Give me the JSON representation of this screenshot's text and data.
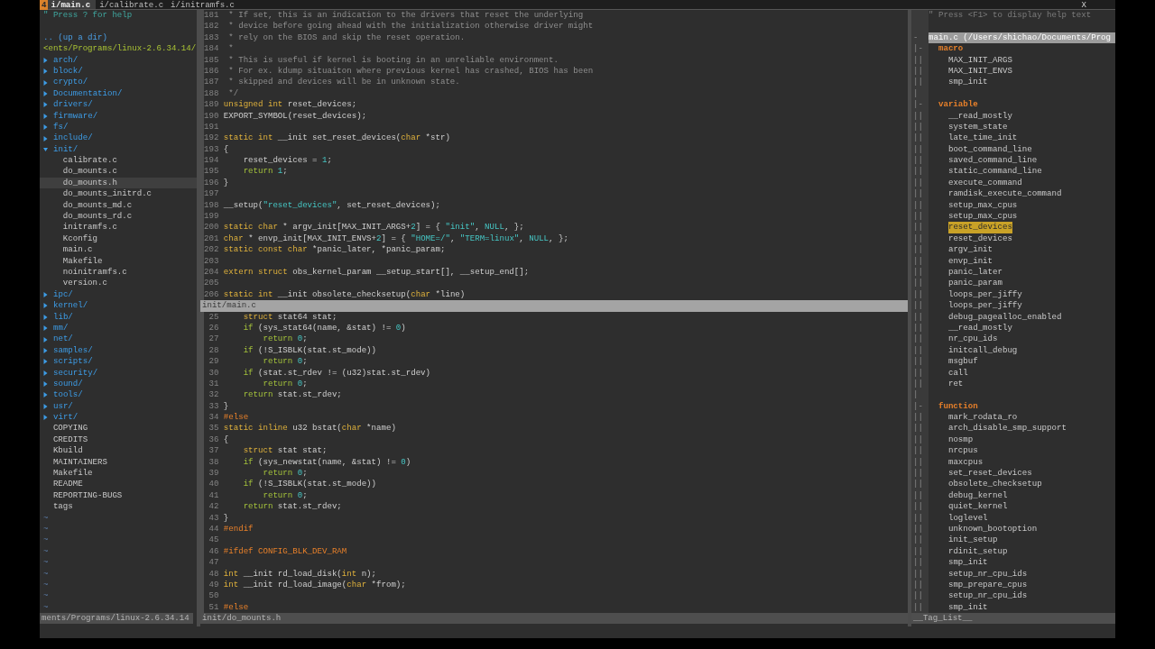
{
  "tabline": {
    "tabs": [
      {
        "count": "4",
        "label": "i/main.c",
        "selected": true
      },
      {
        "label": "i/calibrate.c",
        "selected": false
      },
      {
        "label": "i/initramfs.c",
        "selected": false
      }
    ],
    "close": "X"
  },
  "file_tree": {
    "help": "\" Press ? for help",
    "up_dir": ".. (up a dir)",
    "root": "<ents/Programs/linux-2.6.34.14/",
    "items": [
      {
        "kind": "dir",
        "name": "arch/",
        "expanded": false,
        "selected": false
      },
      {
        "kind": "dir",
        "name": "block/",
        "expanded": false,
        "selected": false
      },
      {
        "kind": "dir",
        "name": "crypto/",
        "expanded": false,
        "selected": false
      },
      {
        "kind": "dir",
        "name": "Documentation/",
        "expanded": false,
        "selected": false
      },
      {
        "kind": "dir",
        "name": "drivers/",
        "expanded": false,
        "selected": false
      },
      {
        "kind": "dir",
        "name": "firmware/",
        "expanded": false,
        "selected": false
      },
      {
        "kind": "dir",
        "name": "fs/",
        "expanded": false,
        "selected": false
      },
      {
        "kind": "dir",
        "name": "include/",
        "expanded": false,
        "selected": false
      },
      {
        "kind": "dir",
        "name": "init/",
        "expanded": true,
        "selected": false,
        "children": [
          {
            "kind": "file",
            "name": "calibrate.c",
            "selected": false
          },
          {
            "kind": "file",
            "name": "do_mounts.c",
            "selected": false
          },
          {
            "kind": "file",
            "name": "do_mounts.h",
            "selected": true
          },
          {
            "kind": "file",
            "name": "do_mounts_initrd.c",
            "selected": false
          },
          {
            "kind": "file",
            "name": "do_mounts_md.c",
            "selected": false
          },
          {
            "kind": "file",
            "name": "do_mounts_rd.c",
            "selected": false
          },
          {
            "kind": "file",
            "name": "initramfs.c",
            "selected": false
          },
          {
            "kind": "file",
            "name": "Kconfig",
            "selected": false
          },
          {
            "kind": "file",
            "name": "main.c",
            "selected": false
          },
          {
            "kind": "file",
            "name": "Makefile",
            "selected": false
          },
          {
            "kind": "file",
            "name": "noinitramfs.c",
            "selected": false
          },
          {
            "kind": "file",
            "name": "version.c",
            "selected": false
          }
        ]
      },
      {
        "kind": "dir",
        "name": "ipc/",
        "expanded": false,
        "selected": false
      },
      {
        "kind": "dir",
        "name": "kernel/",
        "expanded": false,
        "selected": false
      },
      {
        "kind": "dir",
        "name": "lib/",
        "expanded": false,
        "selected": false
      },
      {
        "kind": "dir",
        "name": "mm/",
        "expanded": false,
        "selected": false
      },
      {
        "kind": "dir",
        "name": "net/",
        "expanded": false,
        "selected": false
      },
      {
        "kind": "dir",
        "name": "samples/",
        "expanded": false,
        "selected": false
      },
      {
        "kind": "dir",
        "name": "scripts/",
        "expanded": false,
        "selected": false
      },
      {
        "kind": "dir",
        "name": "security/",
        "expanded": false,
        "selected": false
      },
      {
        "kind": "dir",
        "name": "sound/",
        "expanded": false,
        "selected": false
      },
      {
        "kind": "dir",
        "name": "tools/",
        "expanded": false,
        "selected": false
      },
      {
        "kind": "dir",
        "name": "usr/",
        "expanded": false,
        "selected": false
      },
      {
        "kind": "dir",
        "name": "virt/",
        "expanded": false,
        "selected": false
      },
      {
        "kind": "file",
        "name": "COPYING",
        "selected": false
      },
      {
        "kind": "file",
        "name": "CREDITS",
        "selected": false
      },
      {
        "kind": "file",
        "name": "Kbuild",
        "selected": false
      },
      {
        "kind": "file",
        "name": "MAINTAINERS",
        "selected": false
      },
      {
        "kind": "file",
        "name": "Makefile",
        "selected": false
      },
      {
        "kind": "file",
        "name": "README",
        "selected": false
      },
      {
        "kind": "file",
        "name": "REPORTING-BUGS",
        "selected": false
      },
      {
        "kind": "file",
        "name": "tags",
        "selected": false
      }
    ],
    "filler": [
      "~",
      "~",
      "~",
      "~",
      "~",
      "~",
      "~",
      "~",
      "~"
    ],
    "status": {
      "text": "ments/Programs/linux-2.6.34.14",
      "current": false
    }
  },
  "editor": {
    "windows": [
      {
        "status": {
          "text": "init/main.c",
          "current": true
        },
        "lines": [
          {
            "num": "181",
            "segments": [
              {
                "kind": "comment",
                "text": " * If set, this is an indication to the drivers that reset the underlying"
              }
            ]
          },
          {
            "num": "182",
            "segments": [
              {
                "kind": "comment",
                "text": " * device before going ahead with the initialization otherwise driver might"
              }
            ]
          },
          {
            "num": "183",
            "segments": [
              {
                "kind": "comment",
                "text": " * rely on the BIOS and skip the reset operation."
              }
            ]
          },
          {
            "num": "184",
            "segments": [
              {
                "kind": "comment",
                "text": " *"
              }
            ]
          },
          {
            "num": "185",
            "segments": [
              {
                "kind": "comment",
                "text": " * This is useful if kernel is booting in an unreliable environment."
              }
            ]
          },
          {
            "num": "186",
            "segments": [
              {
                "kind": "comment",
                "text": " * For ex. kdump situaiton where previous kernel has crashed, BIOS has been"
              }
            ]
          },
          {
            "num": "187",
            "segments": [
              {
                "kind": "comment",
                "text": " * skipped and devices will be in unknown state."
              }
            ]
          },
          {
            "num": "188",
            "segments": [
              {
                "kind": "comment",
                "text": " */"
              }
            ]
          },
          {
            "num": "189",
            "segments": [
              {
                "kind": "type",
                "text": "unsigned int"
              },
              {
                "kind": "plain",
                "text": " reset_devices;"
              }
            ]
          },
          {
            "num": "190",
            "segments": [
              {
                "kind": "plain",
                "text": "EXPORT_SYMBOL(reset_devices);"
              }
            ]
          },
          {
            "num": "191"
          },
          {
            "num": "192",
            "segments": [
              {
                "kind": "type",
                "text": "static int"
              },
              {
                "kind": "plain",
                "text": " __init set_reset_devices("
              },
              {
                "kind": "type",
                "text": "char"
              },
              {
                "kind": "plain",
                "text": " *str)"
              }
            ]
          },
          {
            "num": "193",
            "segments": [
              {
                "kind": "plain",
                "text": "{"
              }
            ]
          },
          {
            "num": "194",
            "segments": [
              {
                "kind": "plain",
                "text": "    reset_devices = "
              },
              {
                "kind": "constant",
                "text": "1"
              },
              {
                "kind": "plain",
                "text": ";"
              }
            ]
          },
          {
            "num": "195",
            "segments": [
              {
                "kind": "statement",
                "text": "    return"
              },
              {
                "kind": "constant",
                "text": " 1"
              },
              {
                "kind": "plain",
                "text": ";"
              }
            ]
          },
          {
            "num": "196",
            "segments": [
              {
                "kind": "plain",
                "text": "}"
              }
            ]
          },
          {
            "num": "197"
          },
          {
            "num": "198",
            "segments": [
              {
                "kind": "plain",
                "text": "__setup("
              },
              {
                "kind": "constant",
                "text": "\"reset_devices\""
              },
              {
                "kind": "plain",
                "text": ", set_reset_devices);"
              }
            ]
          },
          {
            "num": "199"
          },
          {
            "num": "200",
            "segments": [
              {
                "kind": "type",
                "text": "static char"
              },
              {
                "kind": "plain",
                "text": " * argv_init[MAX_INIT_ARGS+"
              },
              {
                "kind": "constant",
                "text": "2"
              },
              {
                "kind": "plain",
                "text": "] = { "
              },
              {
                "kind": "constant",
                "text": "\"init\""
              },
              {
                "kind": "plain",
                "text": ", "
              },
              {
                "kind": "constant",
                "text": "NULL"
              },
              {
                "kind": "plain",
                "text": ", };"
              }
            ]
          },
          {
            "num": "201",
            "segments": [
              {
                "kind": "type",
                "text": "char"
              },
              {
                "kind": "plain",
                "text": " * envp_init[MAX_INIT_ENVS+"
              },
              {
                "kind": "constant",
                "text": "2"
              },
              {
                "kind": "plain",
                "text": "] = { "
              },
              {
                "kind": "constant",
                "text": "\"HOME=/\""
              },
              {
                "kind": "plain",
                "text": ", "
              },
              {
                "kind": "constant",
                "text": "\"TERM=linux\""
              },
              {
                "kind": "plain",
                "text": ", "
              },
              {
                "kind": "constant",
                "text": "NULL"
              },
              {
                "kind": "plain",
                "text": ", };"
              }
            ]
          },
          {
            "num": "202",
            "segments": [
              {
                "kind": "type",
                "text": "static const char"
              },
              {
                "kind": "plain",
                "text": " *panic_later, *panic_param;"
              }
            ]
          },
          {
            "num": "203"
          },
          {
            "num": "204",
            "segments": [
              {
                "kind": "type",
                "text": "extern struct"
              },
              {
                "kind": "plain",
                "text": " obs_kernel_param __setup_start[], __setup_end[];"
              }
            ]
          },
          {
            "num": "205"
          },
          {
            "num": "206",
            "segments": [
              {
                "kind": "type",
                "text": "static int"
              },
              {
                "kind": "plain",
                "text": " __init obsolete_checksetup("
              },
              {
                "kind": "type",
                "text": "char"
              },
              {
                "kind": "plain",
                "text": " *line)"
              }
            ]
          }
        ]
      },
      {
        "status": {
          "text": "init/do_mounts.h",
          "current": false
        },
        "lines": [
          {
            "num": "25",
            "segments": [
              {
                "kind": "type",
                "text": "    struct"
              },
              {
                "kind": "plain",
                "text": " stat64 stat;"
              }
            ]
          },
          {
            "num": "26",
            "segments": [
              {
                "kind": "statement",
                "text": "    if"
              },
              {
                "kind": "plain",
                "text": " (sys_stat64(name, &stat) != "
              },
              {
                "kind": "constant",
                "text": "0"
              },
              {
                "kind": "plain",
                "text": ")"
              }
            ]
          },
          {
            "num": "27",
            "segments": [
              {
                "kind": "statement",
                "text": "        return"
              },
              {
                "kind": "constant",
                "text": " 0"
              },
              {
                "kind": "plain",
                "text": ";"
              }
            ]
          },
          {
            "num": "28",
            "segments": [
              {
                "kind": "statement",
                "text": "    if"
              },
              {
                "kind": "plain",
                "text": " (!S_ISBLK(stat.st_mode))"
              }
            ]
          },
          {
            "num": "29",
            "segments": [
              {
                "kind": "statement",
                "text": "        return"
              },
              {
                "kind": "constant",
                "text": " 0"
              },
              {
                "kind": "plain",
                "text": ";"
              }
            ]
          },
          {
            "num": "30",
            "segments": [
              {
                "kind": "statement",
                "text": "    if"
              },
              {
                "kind": "plain",
                "text": " (stat.st_rdev != (u32)stat.st_rdev)"
              }
            ]
          },
          {
            "num": "31",
            "segments": [
              {
                "kind": "statement",
                "text": "        return"
              },
              {
                "kind": "constant",
                "text": " 0"
              },
              {
                "kind": "plain",
                "text": ";"
              }
            ]
          },
          {
            "num": "32",
            "segments": [
              {
                "kind": "statement",
                "text": "    return"
              },
              {
                "kind": "plain",
                "text": " stat.st_rdev;"
              }
            ]
          },
          {
            "num": "33",
            "segments": [
              {
                "kind": "plain",
                "text": "}"
              }
            ]
          },
          {
            "num": "34",
            "segments": [
              {
                "kind": "preproc",
                "text": "#else"
              }
            ]
          },
          {
            "num": "35",
            "segments": [
              {
                "kind": "type",
                "text": "static inline"
              },
              {
                "kind": "plain",
                "text": " u32 bstat("
              },
              {
                "kind": "type",
                "text": "char"
              },
              {
                "kind": "plain",
                "text": " *name)"
              }
            ]
          },
          {
            "num": "36",
            "segments": [
              {
                "kind": "plain",
                "text": "{"
              }
            ]
          },
          {
            "num": "37",
            "segments": [
              {
                "kind": "type",
                "text": "    struct"
              },
              {
                "kind": "plain",
                "text": " stat stat;"
              }
            ]
          },
          {
            "num": "38",
            "segments": [
              {
                "kind": "statement",
                "text": "    if"
              },
              {
                "kind": "plain",
                "text": " (sys_newstat(name, &stat) != "
              },
              {
                "kind": "constant",
                "text": "0"
              },
              {
                "kind": "plain",
                "text": ")"
              }
            ]
          },
          {
            "num": "39",
            "segments": [
              {
                "kind": "statement",
                "text": "        return"
              },
              {
                "kind": "constant",
                "text": " 0"
              },
              {
                "kind": "plain",
                "text": ";"
              }
            ]
          },
          {
            "num": "40",
            "segments": [
              {
                "kind": "statement",
                "text": "    if"
              },
              {
                "kind": "plain",
                "text": " (!S_ISBLK(stat.st_mode))"
              }
            ]
          },
          {
            "num": "41",
            "segments": [
              {
                "kind": "statement",
                "text": "        return"
              },
              {
                "kind": "constant",
                "text": " 0"
              },
              {
                "kind": "plain",
                "text": ";"
              }
            ]
          },
          {
            "num": "42",
            "segments": [
              {
                "kind": "statement",
                "text": "    return"
              },
              {
                "kind": "plain",
                "text": " stat.st_rdev;"
              }
            ]
          },
          {
            "num": "43",
            "segments": [
              {
                "kind": "plain",
                "text": "}"
              }
            ]
          },
          {
            "num": "44",
            "segments": [
              {
                "kind": "preproc",
                "text": "#endif"
              }
            ]
          },
          {
            "num": "45"
          },
          {
            "num": "46",
            "segments": [
              {
                "kind": "preproc",
                "text": "#ifdef CONFIG_BLK_DEV_RAM"
              }
            ]
          },
          {
            "num": "47"
          },
          {
            "num": "48",
            "segments": [
              {
                "kind": "type",
                "text": "int"
              },
              {
                "kind": "plain",
                "text": " __init rd_load_disk("
              },
              {
                "kind": "type",
                "text": "int"
              },
              {
                "kind": "plain",
                "text": " n);"
              }
            ]
          },
          {
            "num": "49",
            "segments": [
              {
                "kind": "type",
                "text": "int"
              },
              {
                "kind": "plain",
                "text": " __init rd_load_image("
              },
              {
                "kind": "type",
                "text": "char"
              },
              {
                "kind": "plain",
                "text": " *from);"
              }
            ]
          },
          {
            "num": "50"
          },
          {
            "num": "51",
            "segments": [
              {
                "kind": "preproc",
                "text": "#else"
              }
            ]
          }
        ]
      }
    ]
  },
  "tag_list": {
    "help": "\" Press <F1> to display help text",
    "header": {
      "fold": "-",
      "text": "main.c (/Users/shichao/Documents/Prog"
    },
    "groups": [
      {
        "fold": "|-",
        "name": "macro",
        "separator": "|",
        "tags": [
          {
            "fold": "||",
            "name": "MAX_INIT_ARGS",
            "selected": false
          },
          {
            "fold": "||",
            "name": "MAX_INIT_ENVS",
            "selected": false
          },
          {
            "fold": "||",
            "name": "smp_init",
            "selected": false
          }
        ]
      },
      {
        "fold": "|-",
        "name": "variable",
        "separator": "|",
        "tags": [
          {
            "fold": "||",
            "name": "__read_mostly",
            "selected": false
          },
          {
            "fold": "||",
            "name": "system_state",
            "selected": false
          },
          {
            "fold": "||",
            "name": "late_time_init",
            "selected": false
          },
          {
            "fold": "||",
            "name": "boot_command_line",
            "selected": false
          },
          {
            "fold": "||",
            "name": "saved_command_line",
            "selected": false
          },
          {
            "fold": "||",
            "name": "static_command_line",
            "selected": false
          },
          {
            "fold": "||",
            "name": "execute_command",
            "selected": false
          },
          {
            "fold": "||",
            "name": "ramdisk_execute_command",
            "selected": false
          },
          {
            "fold": "||",
            "name": "setup_max_cpus",
            "selected": false
          },
          {
            "fold": "||",
            "name": "setup_max_cpus",
            "selected": false
          },
          {
            "fold": "||",
            "name": "reset_devices",
            "selected": true
          },
          {
            "fold": "||",
            "name": "reset_devices",
            "selected": false
          },
          {
            "fold": "||",
            "name": "argv_init",
            "selected": false
          },
          {
            "fold": "||",
            "name": "envp_init",
            "selected": false
          },
          {
            "fold": "||",
            "name": "panic_later",
            "selected": false
          },
          {
            "fold": "||",
            "name": "panic_param",
            "selected": false
          },
          {
            "fold": "||",
            "name": "loops_per_jiffy",
            "selected": false
          },
          {
            "fold": "||",
            "name": "loops_per_jiffy",
            "selected": false
          },
          {
            "fold": "||",
            "name": "debug_pagealloc_enabled",
            "selected": false
          },
          {
            "fold": "||",
            "name": "__read_mostly",
            "selected": false
          },
          {
            "fold": "||",
            "name": "nr_cpu_ids",
            "selected": false
          },
          {
            "fold": "||",
            "name": "initcall_debug",
            "selected": false
          },
          {
            "fold": "||",
            "name": "msgbuf",
            "selected": false
          },
          {
            "fold": "||",
            "name": "call",
            "selected": false
          },
          {
            "fold": "||",
            "name": "ret",
            "selected": false
          }
        ]
      },
      {
        "fold": "|-",
        "name": "function",
        "tags": [
          {
            "fold": "||",
            "name": "mark_rodata_ro",
            "selected": false
          },
          {
            "fold": "||",
            "name": "arch_disable_smp_support",
            "selected": false
          },
          {
            "fold": "||",
            "name": "nosmp",
            "selected": false
          },
          {
            "fold": "||",
            "name": "nrcpus",
            "selected": false
          },
          {
            "fold": "||",
            "name": "maxcpus",
            "selected": false
          },
          {
            "fold": "||",
            "name": "set_reset_devices",
            "selected": false
          },
          {
            "fold": "||",
            "name": "obsolete_checksetup",
            "selected": false
          },
          {
            "fold": "||",
            "name": "debug_kernel",
            "selected": false
          },
          {
            "fold": "||",
            "name": "quiet_kernel",
            "selected": false
          },
          {
            "fold": "||",
            "name": "loglevel",
            "selected": false
          },
          {
            "fold": "||",
            "name": "unknown_bootoption",
            "selected": false
          },
          {
            "fold": "||",
            "name": "init_setup",
            "selected": false
          },
          {
            "fold": "||",
            "name": "rdinit_setup",
            "selected": false
          },
          {
            "fold": "||",
            "name": "smp_init",
            "selected": false
          },
          {
            "fold": "||",
            "name": "setup_nr_cpu_ids",
            "selected": false
          },
          {
            "fold": "||",
            "name": "smp_prepare_cpus",
            "selected": false
          },
          {
            "fold": "||",
            "name": "setup_nr_cpu_ids",
            "selected": false
          },
          {
            "fold": "||",
            "name": "smp_init",
            "selected": false
          }
        ]
      }
    ],
    "status": {
      "text": "__Tag_List__",
      "current": false
    }
  }
}
